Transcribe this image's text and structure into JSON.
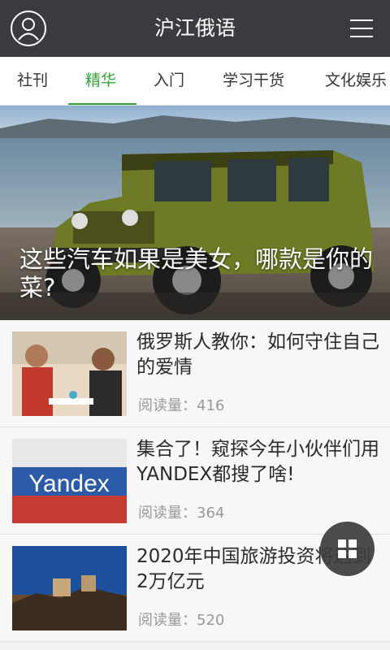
{
  "header": {
    "title": "沪江俄语",
    "avatar_icon": "user-avatar-icon",
    "menu_icon": "hamburger-menu-icon"
  },
  "tabs": [
    {
      "label": "社刊"
    },
    {
      "label": "精华"
    },
    {
      "label": "入门"
    },
    {
      "label": "学习干货"
    },
    {
      "label": "文化娱乐"
    }
  ],
  "active_tab": "精华",
  "hero": {
    "caption": "这些汽车如果是美女，哪款是你的菜?"
  },
  "articles": [
    {
      "title": "俄罗斯人教你：如何守住自己的爱情",
      "meta": "阅读量：416"
    },
    {
      "title": "集合了！窥探今年小伙伴们用YANDEX都搜了啥!",
      "meta": "阅读量：364",
      "thumb_text": "Yandex"
    },
    {
      "title": "2020年中国旅游投资将达到2万亿元",
      "meta": "阅读量：520"
    }
  ],
  "fab_icon": "grid-apps-icon",
  "colors": {
    "header_bg": "#3a3b3e",
    "accent": "#34a338"
  }
}
